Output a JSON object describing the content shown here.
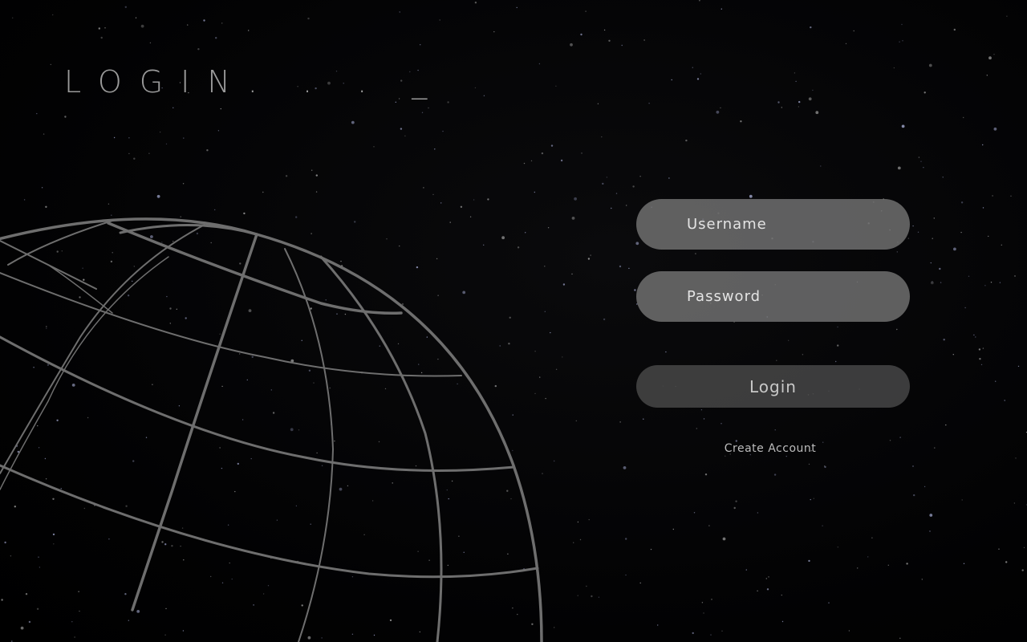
{
  "page": {
    "title": "LOGIN. . . _"
  },
  "form": {
    "username_placeholder": "Username",
    "password_placeholder": "Password",
    "login_label": "Login",
    "create_account_label": "Create Account"
  },
  "colors": {
    "background": "#000000",
    "field_fill": "#787878",
    "button_fill": "#464646",
    "globe_line": "#6e6e6e",
    "title_text": "#9a9a9a"
  },
  "icons": {
    "background": "starfield",
    "decoration": "wireframe-globe"
  }
}
